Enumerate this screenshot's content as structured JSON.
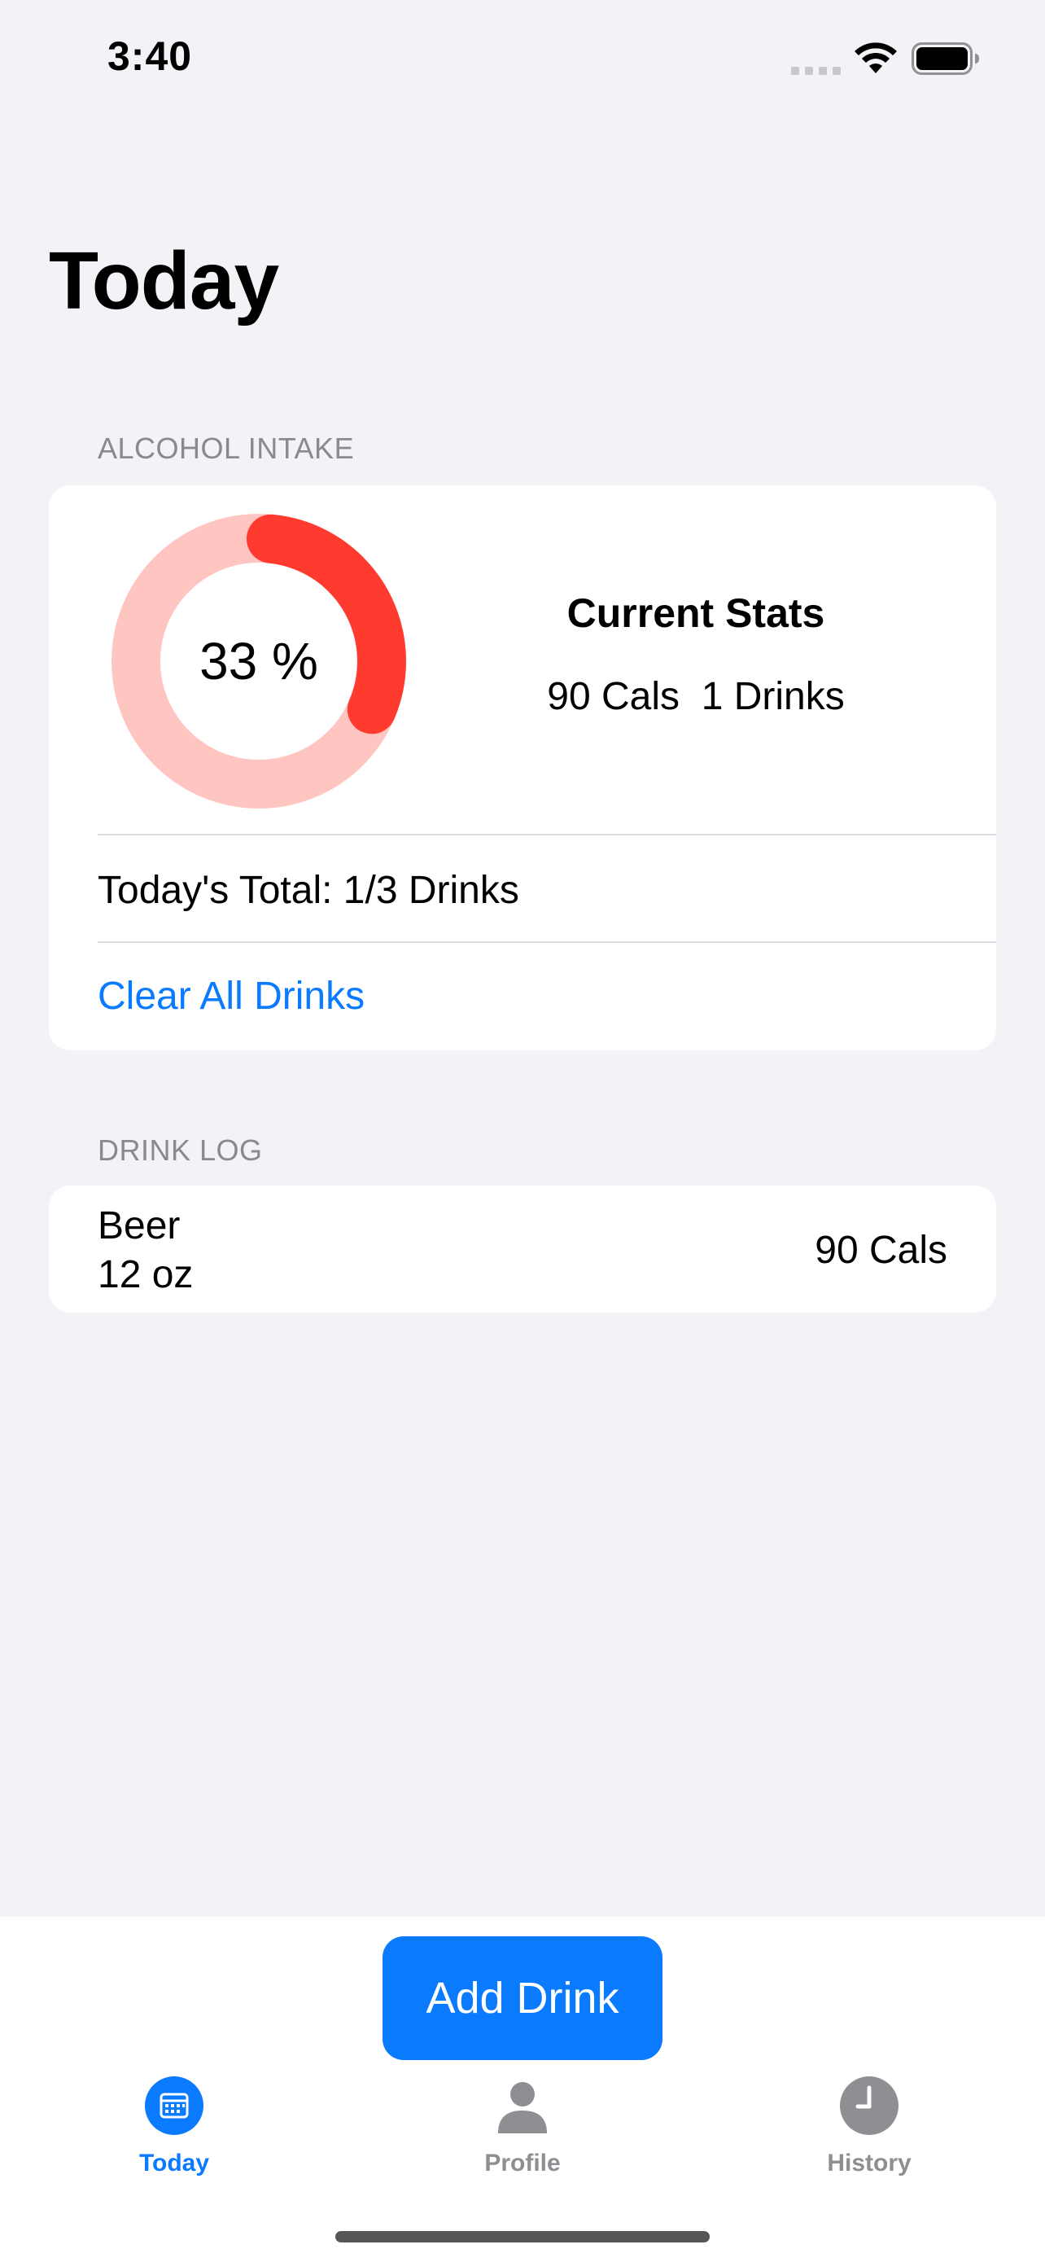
{
  "status_bar": {
    "time": "3:40",
    "signal_icon": "cellular-signal-icon",
    "wifi_icon": "wifi-icon",
    "battery_icon": "battery-full-icon"
  },
  "page": {
    "title": "Today"
  },
  "intake": {
    "header": "ALCOHOL INTAKE",
    "progress": 0.33,
    "progress_label": "33 %",
    "colors": {
      "ring_track": "#ffc5c0",
      "ring_fill": "#ff3b30"
    },
    "stats_title": "Current Stats",
    "stats_values": "90 Cals  1 Drinks",
    "total": "Today's Total: 1/3 Drinks",
    "clear_label": "Clear All Drinks"
  },
  "drink_log": {
    "header": "DRINK LOG",
    "items": [
      {
        "name": "Beer",
        "size": "12 oz",
        "calories": "90 Cals"
      }
    ]
  },
  "bottom": {
    "add_button": "Add Drink",
    "accent_color": "#0a7aff",
    "tabs": [
      {
        "label": "Today",
        "icon": "calendar-icon",
        "active": true
      },
      {
        "label": "Profile",
        "icon": "person-icon",
        "active": false
      },
      {
        "label": "History",
        "icon": "clock-icon",
        "active": false
      }
    ]
  }
}
